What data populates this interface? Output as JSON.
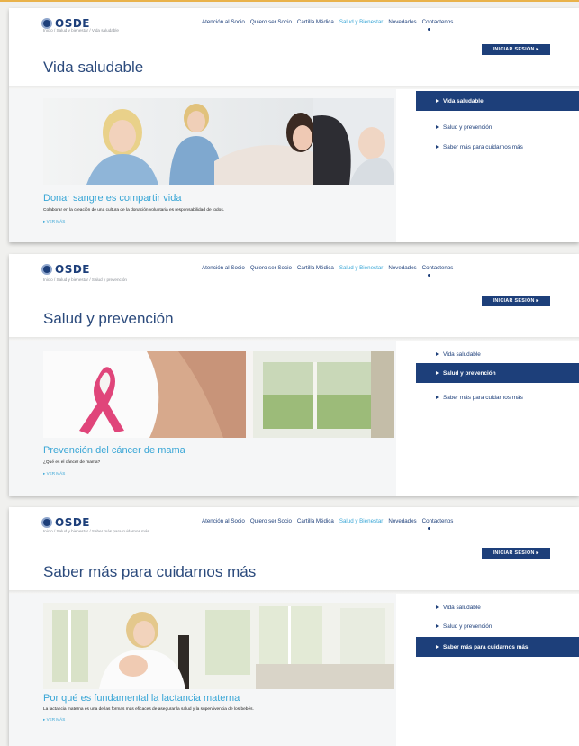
{
  "brand": {
    "logo_text": "OSDE"
  },
  "nav": [
    "Atención al Socio",
    "Quiero ser Socio",
    "Cartilla Médica",
    "Salud y Bienestar",
    "Novedades",
    "Contactenos"
  ],
  "login_label": "INICIAR SESIÓN ▸",
  "sidebar_labels": [
    "Vida saludable",
    "Salud y prevención",
    "Saber más para cuidarnos más"
  ],
  "more_label": "▸ VER MÁS",
  "panels": [
    {
      "breadcrumb": "Inicio  /  Salud y bienestar  /  Vida saludable",
      "title": "Vida saludable",
      "article_title": "Donar sangre es compartir vida",
      "article_desc": "Colaborar en la creación de una cultura de la donación voluntaria es responsabilidad de todos."
    },
    {
      "breadcrumb": "Inicio  /  Salud y bienestar  /  Salud y prevención",
      "title": "Salud y prevención",
      "article_title": "Prevención del cáncer de mama",
      "article_desc": "¿Qué es el cáncer de mama?"
    },
    {
      "breadcrumb": "Inicio  /  Salud y bienestar  /  Saber más para cuidarnos más",
      "title": "Saber más para cuidarnos más",
      "article_title": "Por qué es fundamental la lactancia materna",
      "article_desc": "La lactancia materna es una de las formas más eficaces de asegurar la salud y la supervivencia de los bebés."
    }
  ],
  "colors": {
    "brand": "#1d3f7a",
    "accent": "#39a6d6",
    "topline": "#e9b24a"
  }
}
